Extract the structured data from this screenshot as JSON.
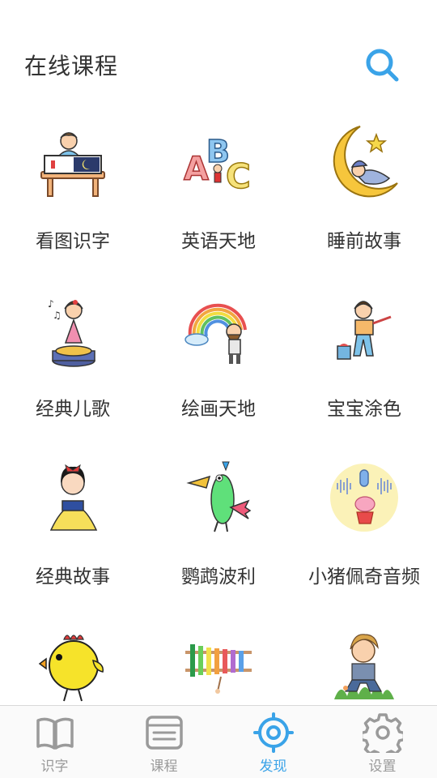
{
  "header": {
    "title": "在线课程"
  },
  "courses": [
    {
      "label": "看图识字",
      "icon": "child-reading-book-icon"
    },
    {
      "label": "英语天地",
      "icon": "abc-letters-icon"
    },
    {
      "label": "睡前故事",
      "icon": "sleeping-baby-moon-icon"
    },
    {
      "label": "经典儿歌",
      "icon": "singing-girl-icon"
    },
    {
      "label": "绘画天地",
      "icon": "painter-rainbow-icon"
    },
    {
      "label": "宝宝涂色",
      "icon": "girl-painting-icon"
    },
    {
      "label": "经典故事",
      "icon": "princess-icon"
    },
    {
      "label": "鹦鹉波利",
      "icon": "parrot-icon"
    },
    {
      "label": "小猪佩奇音频",
      "icon": "peppa-pig-audio-icon"
    },
    {
      "label": "",
      "icon": "yellow-chick-icon"
    },
    {
      "label": "",
      "icon": "xylophone-icon"
    },
    {
      "label": "",
      "icon": "boy-in-grass-icon"
    }
  ],
  "tabbar": {
    "active": "发现",
    "active_color": "#3aa3e8",
    "inactive_color": "#9a9a9a",
    "tabs": [
      {
        "label": "识字",
        "icon": "open-book-icon"
      },
      {
        "label": "课程",
        "icon": "course-list-icon"
      },
      {
        "label": "发现",
        "icon": "target-icon"
      },
      {
        "label": "设置",
        "icon": "gear-icon"
      }
    ]
  }
}
